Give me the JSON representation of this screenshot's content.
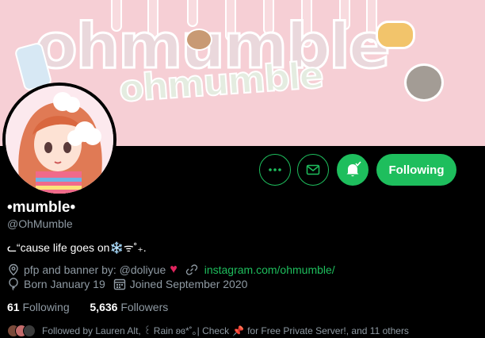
{
  "banner": {
    "watermark_large": "ohmumble",
    "watermark_small": "ohmumble"
  },
  "profile": {
    "display_name": "•mumble•",
    "handle": "@OhMumble",
    "bio": "ᓚ“cause life goes on❄️ᯤ˚₊.",
    "credit_prefix": "pfp and banner by: @doliyue",
    "credit_heart": "♥",
    "website": "instagram.com/ohmumble/",
    "birthday": "Born January 19",
    "joined": "Joined September 2020"
  },
  "stats": {
    "following_count": "61",
    "following_label": "Following",
    "followers_count": "5,636",
    "followers_label": "Followers"
  },
  "followed_by": {
    "text_before_pin": "Followed by Lauren Alt, ꒰ Rain ʚɞ*˚｡| Check",
    "pin": "📌",
    "text_after_pin": "for Free Private Server!, and 11 others"
  },
  "actions": {
    "follow_label": "Following"
  },
  "icons": {
    "more": "more-icon",
    "message": "envelope-icon",
    "notify": "bell-check-icon",
    "location": "location-icon",
    "link": "link-icon",
    "birthday": "balloon-icon",
    "calendar": "calendar-icon"
  },
  "colors": {
    "accent": "#1ebe5d",
    "background": "#000000",
    "muted_text": "#8f9aa3",
    "banner_pink": "#f6cfd5",
    "heart": "#e0245e"
  }
}
